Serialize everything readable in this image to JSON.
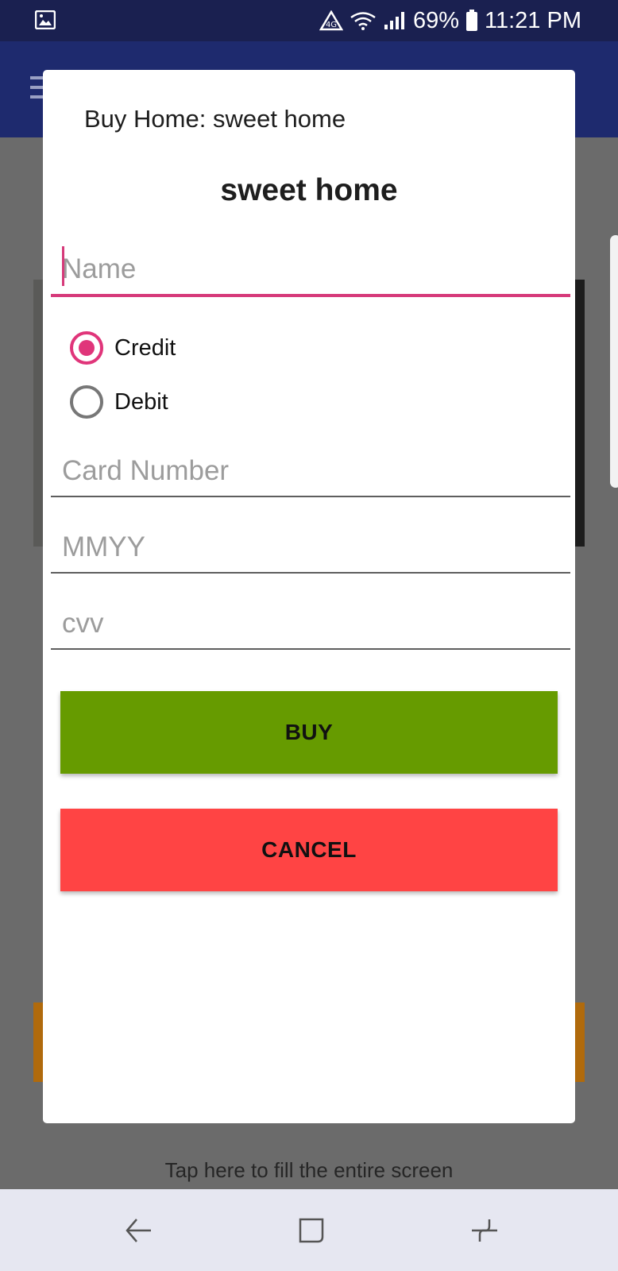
{
  "status_bar": {
    "battery": "69%",
    "time": "11:21 PM",
    "icons": [
      "image-icon",
      "data-saver-icon",
      "wifi-icon",
      "signal-icon",
      "battery-icon"
    ]
  },
  "dialog": {
    "title": "Buy Home: sweet home",
    "heading": "sweet home",
    "name_field": {
      "placeholder": "Name",
      "value": ""
    },
    "payment_options": [
      {
        "label": "Credit",
        "selected": true
      },
      {
        "label": "Debit",
        "selected": false
      }
    ],
    "card_number_field": {
      "placeholder": "Card Number",
      "value": ""
    },
    "expiry_field": {
      "placeholder": "MMYY",
      "value": ""
    },
    "cvv_field": {
      "placeholder": "cvv",
      "value": ""
    },
    "buy_label": "BUY",
    "cancel_label": "CANCEL"
  },
  "fill_screen_hint": "Tap here to fill the entire screen",
  "colors": {
    "accent": "#e0357a",
    "buy_button": "#669b00",
    "cancel_button": "#ff4444",
    "status_bar": "#1a2050",
    "app_bar": "#1e2a6e"
  },
  "navigation": [
    "back-icon",
    "home-icon",
    "recents-icon"
  ]
}
